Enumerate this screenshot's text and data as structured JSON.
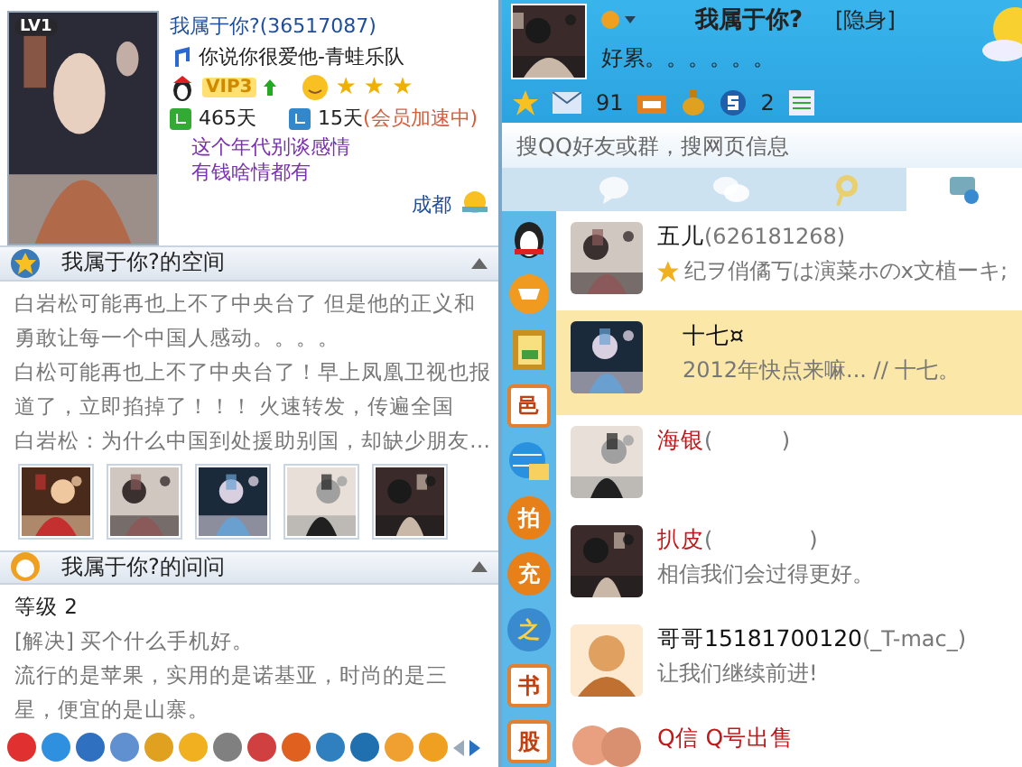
{
  "profile": {
    "level_badge": "LV1",
    "name": "我属于你?(36517087)",
    "song": "你说你很爱他-青蛙乐队",
    "vip": "VIP3",
    "stars": 3,
    "online_days": "465天",
    "member_days": "15天",
    "member_note": "(会员加速中)",
    "mood": [
      "这个年代别谈感情",
      "有钱啥情都有"
    ],
    "city": "成都"
  },
  "space": {
    "title": "我属于你?的空间",
    "expanded": true,
    "lines": [
      "白岩松可能再也上不了中央台了 但是他的正义和",
      "勇敢让每一个中国人感动。。。。",
      "白松可能再也上不了中央台了！早上凤凰卫视也报",
      "道了，立即掐掉了！！！ 火速转发，传遍全国",
      "白岩松：为什么中国到处援助别国，却缺少朋友…"
    ],
    "photos": [
      {
        "kind": "picture"
      },
      {
        "kind": "picture"
      },
      {
        "kind": "picture"
      },
      {
        "kind": "picture"
      },
      {
        "kind": "picture"
      }
    ]
  },
  "wenwen": {
    "title": "我属于你?的问问",
    "expanded": true,
    "grade": "等级 2",
    "question": "[解决] 买个什么手机好。",
    "answer": "流行的是苹果，实用的是诺基亚，时尚的是三星，便宜的是山寨。"
  },
  "account": {
    "name": "我属于你?",
    "status": "[隐身]",
    "mood": "好累。。。。。。",
    "mail_count": "91",
    "s_count": "2"
  },
  "search": {
    "placeholder": "搜QQ好友或群，搜网页信息"
  },
  "tabs": [
    {
      "kind": "chat",
      "selected": false
    },
    {
      "kind": "group",
      "selected": false
    },
    {
      "kind": "zone",
      "selected": false
    },
    {
      "kind": "recent",
      "selected": true
    }
  ],
  "side_icons": [
    {
      "kind": "penguin"
    },
    {
      "kind": "cart"
    },
    {
      "kind": "contacts"
    },
    {
      "kind": "square",
      "label": "邑"
    },
    {
      "kind": "globe"
    },
    {
      "kind": "round",
      "label": "拍"
    },
    {
      "kind": "round",
      "label": "充"
    },
    {
      "kind": "star",
      "label": "之"
    },
    {
      "kind": "square",
      "label": "书"
    },
    {
      "kind": "square",
      "label": "股"
    }
  ],
  "contacts": [
    {
      "name": "五儿",
      "nick": "(626181268)",
      "signature": "纪ヲ俏僪丂は演菜ホのx文植ーキ;",
      "badge": true,
      "vip": false,
      "selected": false
    },
    {
      "name": "十七¤",
      "signature": "2012年快点来嘛...  // 十七。",
      "badge": false,
      "vip": false,
      "selected": true
    },
    {
      "name": "海银",
      "nick": "(          )",
      "badge": false,
      "vip": true,
      "selected": false
    },
    {
      "name": "扒皮",
      "nick": "(              )",
      "signature": "相信我们会过得更好。",
      "badge": false,
      "vip": true,
      "selected": false
    },
    {
      "name": "哥哥15181700120",
      "nick": "(_T-mac_)",
      "signature": "让我们继续前进!",
      "badge": false,
      "vip": false,
      "selected": false
    },
    {
      "name": "Q信 Q号出售",
      "badge": false,
      "vip": true,
      "selected": false
    }
  ]
}
